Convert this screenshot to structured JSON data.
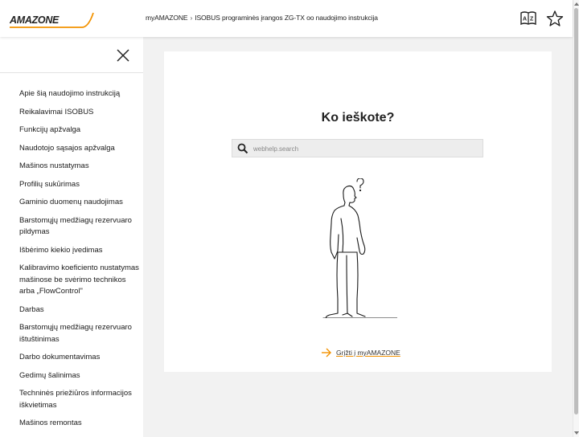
{
  "header": {
    "logo_text": "AMAZONE",
    "breadcrumb": [
      "myAMAZONE",
      "ISOBUS programinės įrangos ZG-TX oo naudojimo instrukcija"
    ],
    "breadcrumb_separator": "›",
    "icons": [
      "dictionary-icon",
      "favorite-star-icon"
    ]
  },
  "sidebar": {
    "items": [
      "Apie šią naudojimo instrukciją",
      "Reikalavimai ISOBUS",
      "Funkcijų apžvalga",
      "Naudotojo sąsajos apžvalga",
      "Mašinos nustatymas",
      "Profilių sukūrimas",
      "Gaminio duomenų naudojimas",
      "Barstomųjų medžiagų rezervuaro pildymas",
      "Išbėrimo kiekio įvedimas",
      "Kalibravimo koeficiento nustatymas mašinose be svėrimo technikos arba „FlowControl\"",
      "Darbas",
      "Barstomųjų medžiagų rezervuaro ištuštinimas",
      "Darbo dokumentavimas",
      "Gedimų šalinimas",
      "Techninės priežiūros informacijos iškvietimas",
      "Mašinos remontas"
    ]
  },
  "main": {
    "title": "Ko ieškote?",
    "search": {
      "placeholder": "webhelp.search",
      "value": ""
    },
    "back_link": "Grįžti į myAMAZONE"
  },
  "colors": {
    "accent": "#f39200",
    "text": "#222222",
    "background": "#f2f2f2"
  }
}
